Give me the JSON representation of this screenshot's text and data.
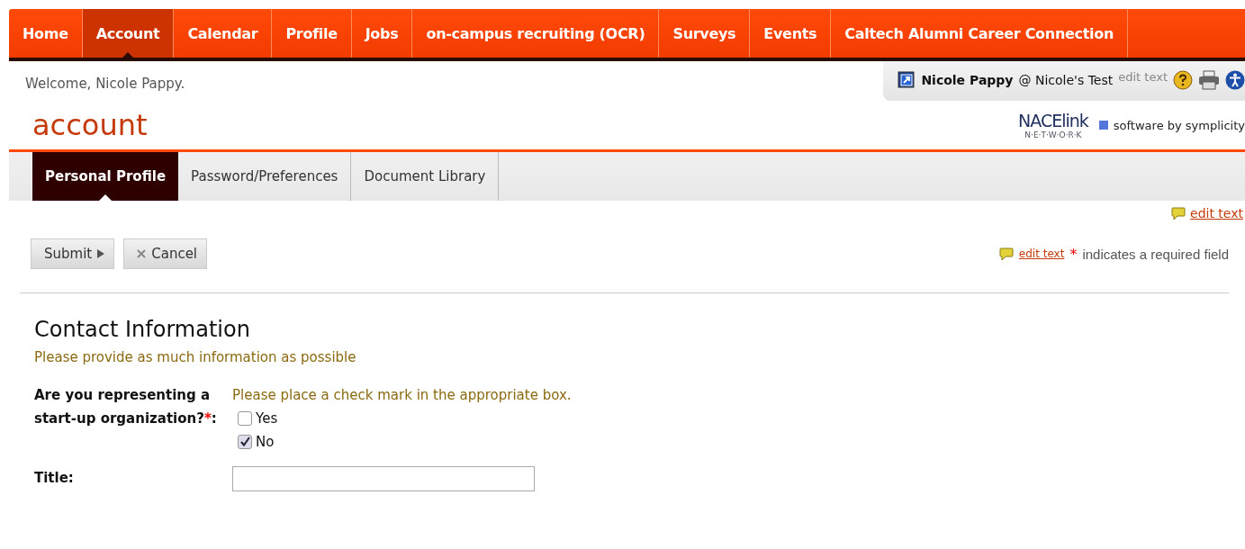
{
  "nav": [
    {
      "label": "Home",
      "selected": false
    },
    {
      "label": "Account",
      "selected": true
    },
    {
      "label": "Calendar",
      "selected": false
    },
    {
      "label": "Profile",
      "selected": false
    },
    {
      "label": "Jobs",
      "selected": false
    },
    {
      "label": "on-campus recruiting (OCR)",
      "selected": false
    },
    {
      "label": "Surveys",
      "selected": false
    },
    {
      "label": "Events",
      "selected": false
    },
    {
      "label": "Caltech Alumni Career Connection",
      "selected": false
    }
  ],
  "welcome": "Welcome, Nicole Pappy.",
  "user_bar": {
    "user": "Nicole Pappy",
    "at": "@ Nicole's Test",
    "edit": "edit text"
  },
  "page_title": "account",
  "logo": {
    "word_a": "NACE",
    "word_b": "link",
    "sub": "N·E·T·W·O·R·K",
    "vendor": "software by symplicity"
  },
  "tabs": [
    {
      "label": "Personal Profile",
      "selected": true
    },
    {
      "label": "Password/Preferences",
      "selected": false
    },
    {
      "label": "Document Library",
      "selected": false
    }
  ],
  "edit_link_top": "edit text",
  "buttons": [
    {
      "kind": "submit",
      "label": "Submit"
    },
    {
      "kind": "cancel",
      "label": "Cancel"
    }
  ],
  "legend": {
    "edit": "edit text",
    "mark": "*",
    "text": "indicates a required field"
  },
  "section": {
    "title": "Contact Information",
    "hint": "Please provide as much information as possible"
  },
  "fields": [
    {
      "kind": "checks",
      "label": "Are you representing a start-up organization?",
      "required_mark": "*",
      "colon": ":",
      "instruction": "Please place a check mark in the appropriate box.",
      "options": [
        {
          "label": "Yes",
          "checked": false
        },
        {
          "label": "No",
          "checked": true
        }
      ]
    },
    {
      "kind": "text",
      "label": "Title:"
    }
  ]
}
